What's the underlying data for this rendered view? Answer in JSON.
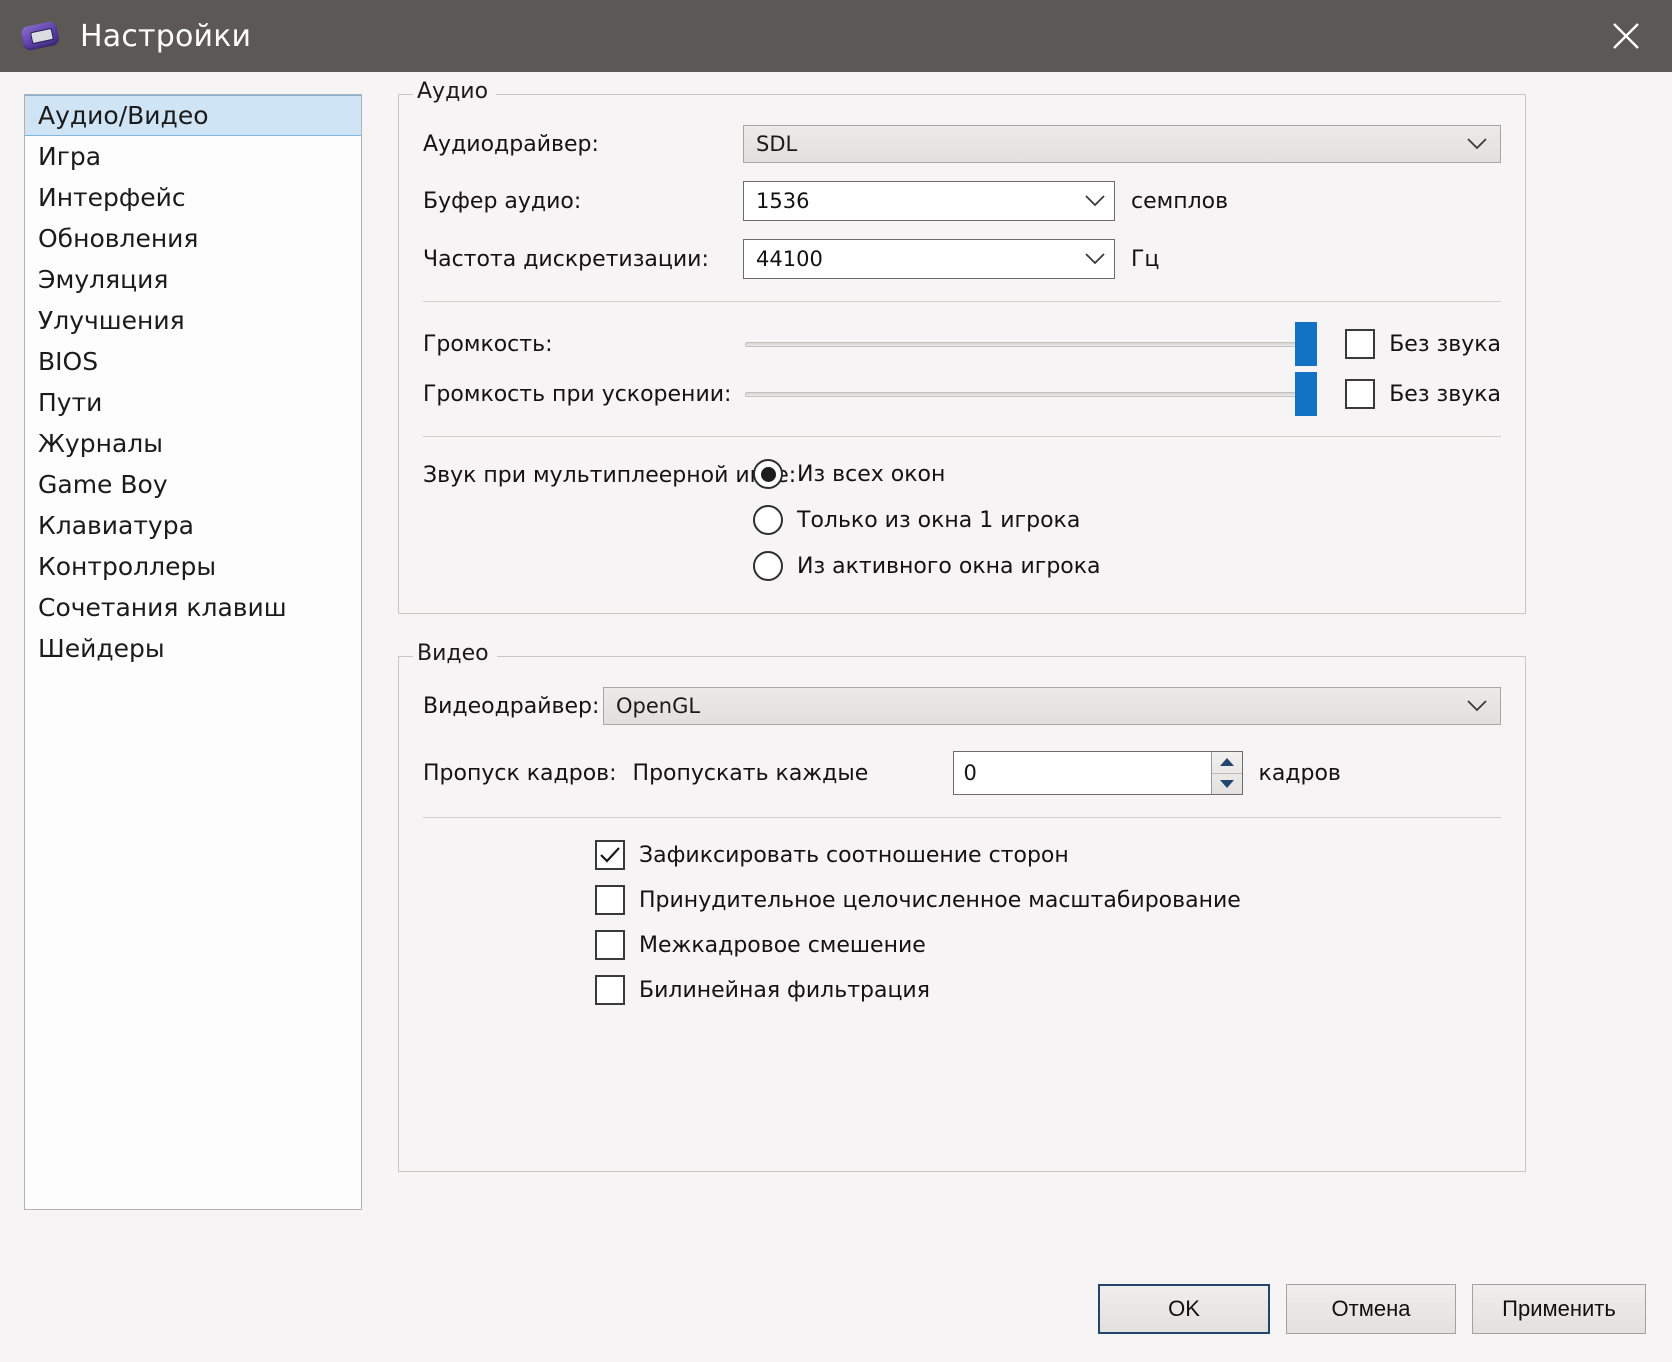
{
  "window": {
    "title": "Настройки",
    "icon": "gameboy-advance-icon",
    "close_label": "✕",
    "titlebar_color": "#5b5856",
    "accent_color": "#1272c4",
    "selection_color": "#cfe4f5"
  },
  "sidebar": {
    "items": [
      {
        "label": "Аудио/Видео",
        "selected": true
      },
      {
        "label": "Игра",
        "selected": false
      },
      {
        "label": "Интерфейс",
        "selected": false
      },
      {
        "label": "Обновления",
        "selected": false
      },
      {
        "label": "Эмуляция",
        "selected": false
      },
      {
        "label": "Улучшения",
        "selected": false
      },
      {
        "label": "BIOS",
        "selected": false
      },
      {
        "label": "Пути",
        "selected": false
      },
      {
        "label": "Журналы",
        "selected": false
      },
      {
        "label": "Game Boy",
        "selected": false
      },
      {
        "label": "Клавиатура",
        "selected": false
      },
      {
        "label": "Контроллеры",
        "selected": false
      },
      {
        "label": "Сочетания клавиш",
        "selected": false
      },
      {
        "label": "Шейдеры",
        "selected": false
      }
    ]
  },
  "audio": {
    "group_title": "Аудио",
    "driver_label": "Аудиодрайвер:",
    "driver_value": "SDL",
    "buffer_label": "Буфер аудио:",
    "buffer_value": "1536",
    "buffer_suffix": "семплов",
    "samplerate_label": "Частота дискретизации:",
    "samplerate_value": "44100",
    "samplerate_suffix": "Гц",
    "volume_label": "Громкость:",
    "volume_mute_label": "Без звука",
    "volume_value": 100,
    "fastforward_label": "Громкость при ускорении:",
    "fastforward_mute_label": "Без звука",
    "fastforward_value": 100,
    "multiplayer_label": "Звук при мультиплеерной игре:",
    "multiplayer_options": [
      {
        "label": "Из всех окон",
        "selected": true
      },
      {
        "label": "Только из окна  1 игрока",
        "selected": false
      },
      {
        "label": "Из активного окна игрока",
        "selected": false
      }
    ]
  },
  "video": {
    "group_title": "Видео",
    "driver_label": "Видеодрайвер:",
    "driver_value": "OpenGL",
    "frameskip_label": "Пропуск кадров:",
    "frameskip_prefix": "Пропускать каждые",
    "frameskip_value": "0",
    "frameskip_suffix": "кадров",
    "checkboxes": [
      {
        "label": "Зафиксировать соотношение сторон",
        "checked": true
      },
      {
        "label": "Принудительное целочисленное масштабирование",
        "checked": false
      },
      {
        "label": "Межкадровое смешение",
        "checked": false
      },
      {
        "label": "Билинейная фильтрация",
        "checked": false
      }
    ]
  },
  "footer": {
    "ok": "OK",
    "cancel": "Отмена",
    "apply": "Применить"
  }
}
